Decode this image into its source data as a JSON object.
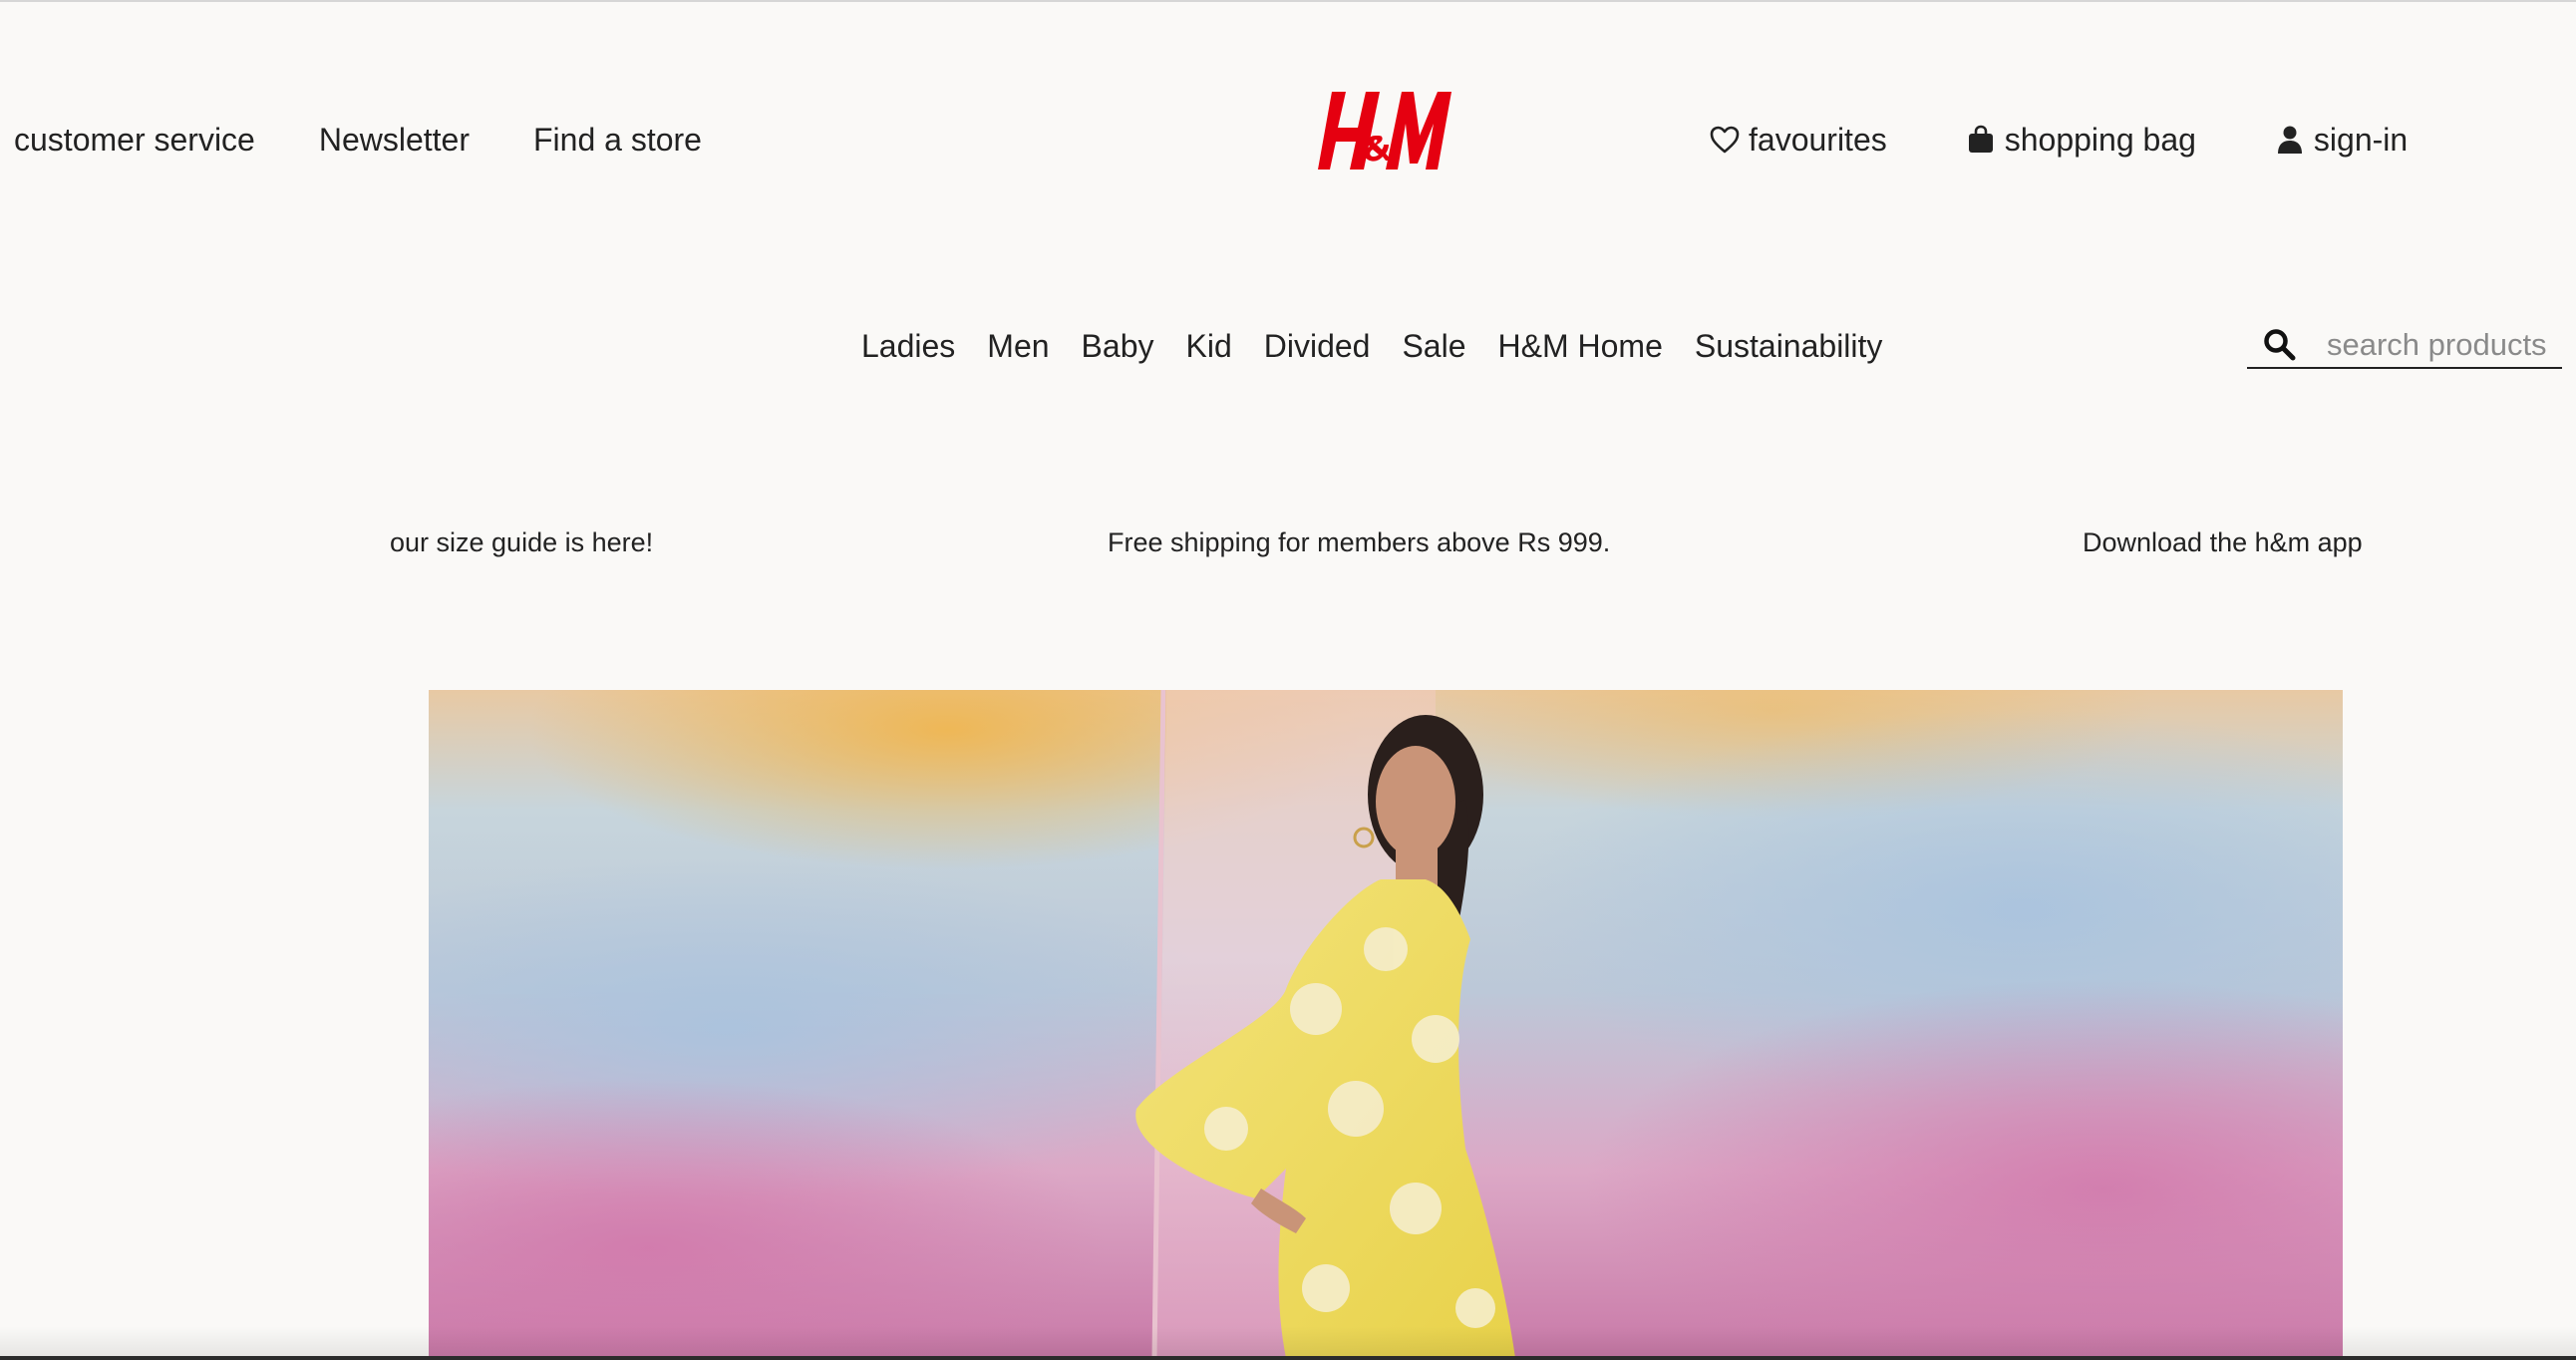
{
  "header": {
    "utility_links": [
      "customer service",
      "Newsletter",
      "Find a store"
    ],
    "logo_icon": "hm-logo-icon",
    "account": {
      "favourites": "favourites",
      "shopping_bag": "shopping bag",
      "sign_in": "sign-in"
    }
  },
  "nav": {
    "items": [
      "Ladies",
      "Men",
      "Baby",
      "Kid",
      "Divided",
      "Sale",
      "H&M Home",
      "Sustainability"
    ]
  },
  "search": {
    "placeholder": "search products"
  },
  "promo": {
    "left": "our size guide is here!",
    "center": "Free shipping for members above Rs 999.",
    "right": "Download the h&m app"
  },
  "hero": {
    "image": "model-in-yellow-floral-dress-photo"
  },
  "colors": {
    "brand_red": "#e50010",
    "background": "#faf9f7",
    "text": "#222222"
  }
}
